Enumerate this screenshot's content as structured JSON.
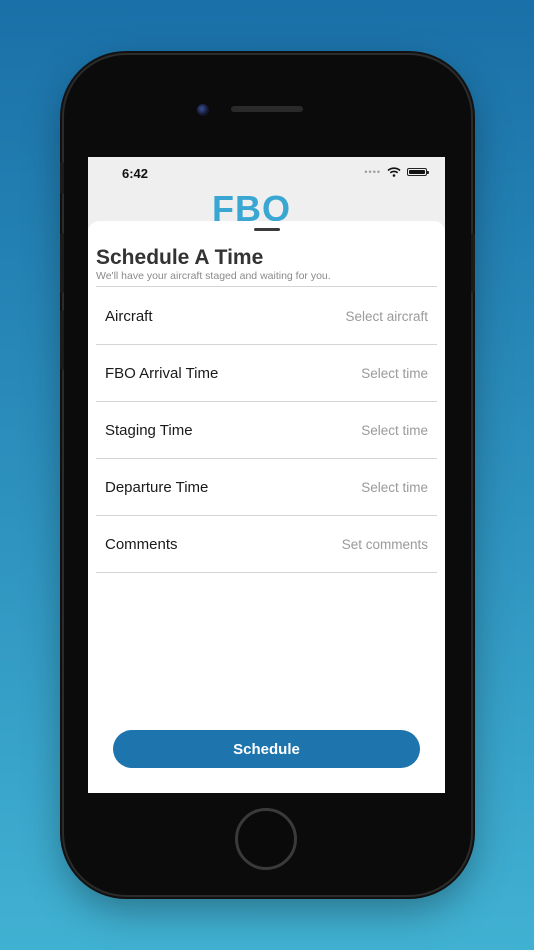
{
  "status_bar": {
    "time": "6:42",
    "signal_icon": "signal-dots-icon",
    "wifi_icon": "wifi-icon",
    "battery_icon": "battery-icon",
    "battery_level": 1.0
  },
  "header": {
    "logo_text": "FBO"
  },
  "sheet": {
    "title": "Schedule A Time",
    "subtitle": "We'll have your aircraft staged and waiting for you.",
    "rows": [
      {
        "label": "Aircraft",
        "value": "Select aircraft"
      },
      {
        "label": "FBO Arrival Time",
        "value": "Select time"
      },
      {
        "label": "Staging Time",
        "value": "Select time"
      },
      {
        "label": "Departure Time",
        "value": "Select time"
      },
      {
        "label": "Comments",
        "value": "Set comments"
      }
    ],
    "schedule_button": "Schedule"
  },
  "colors": {
    "background_top": "#1a70a8",
    "background_bottom": "#41b1d2",
    "logo": "#3aa7d3",
    "button": "#1e74ad"
  }
}
